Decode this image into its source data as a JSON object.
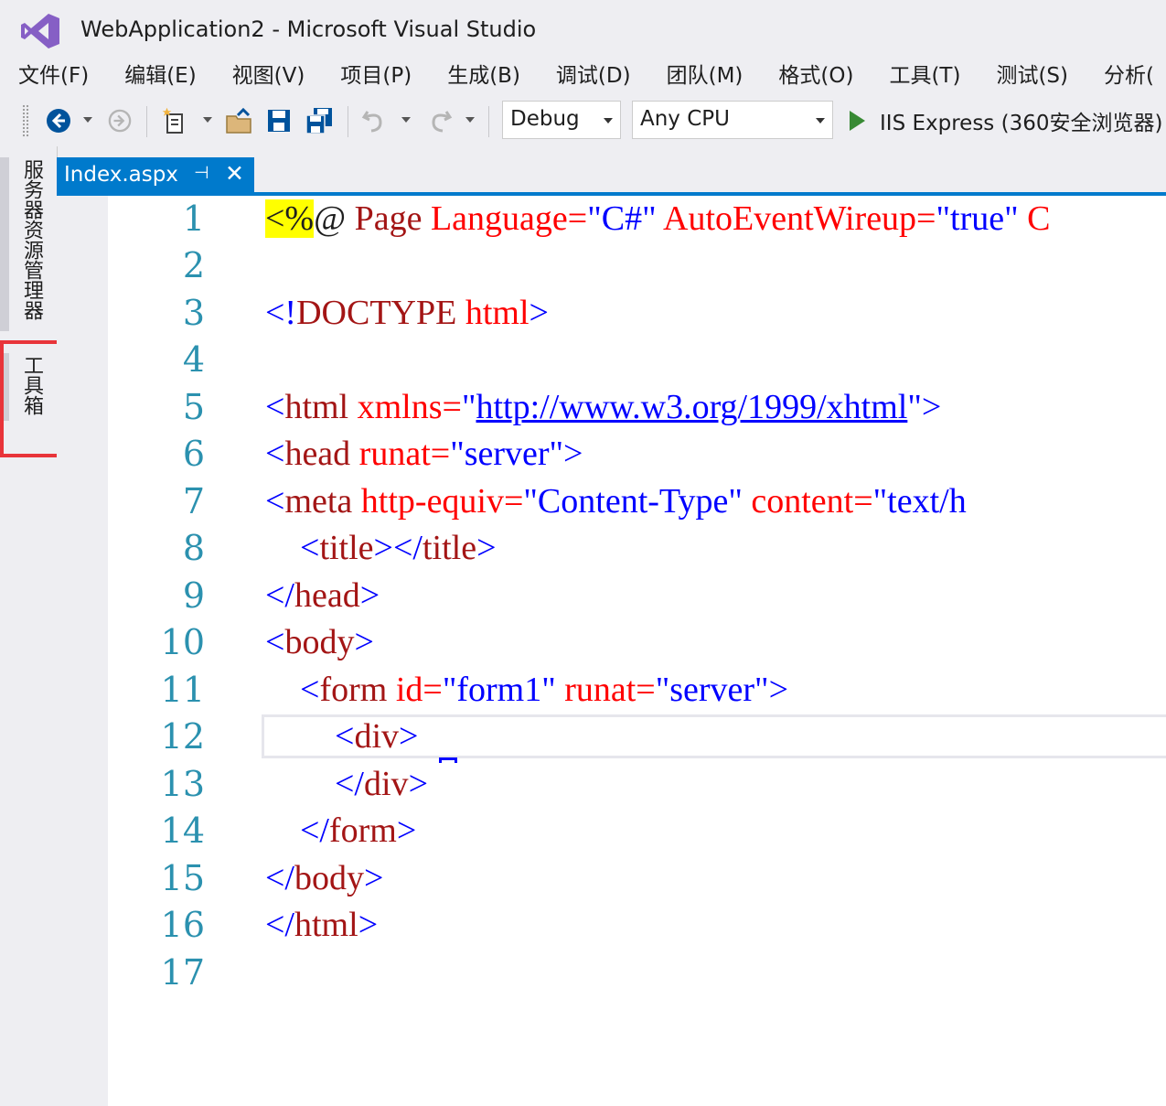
{
  "window": {
    "title": "WebApplication2 - Microsoft Visual Studio"
  },
  "menu": [
    "文件(F)",
    "编辑(E)",
    "视图(V)",
    "项目(P)",
    "生成(B)",
    "调试(D)",
    "团队(M)",
    "格式(O)",
    "工具(T)",
    "测试(S)",
    "分析("
  ],
  "toolbar": {
    "config": "Debug",
    "platform": "Any CPU",
    "run_target": "IIS Express (360安全浏览器)"
  },
  "side_tabs": {
    "server_explorer": "服务器资源管理器",
    "toolbox": "工具箱"
  },
  "document_tab": {
    "name": "Index.aspx",
    "pin": "⊣",
    "close": "✕"
  },
  "editor": {
    "line_numbers": [
      "1",
      "2",
      "3",
      "4",
      "5",
      "6",
      "7",
      "8",
      "9",
      "10",
      "11",
      "12",
      "13",
      "14",
      "15",
      "16",
      "17"
    ],
    "lines": {
      "l1": {
        "a": "<%",
        "b": "@ ",
        "c": "Page ",
        "d": "Language=",
        "e": "\"C#\" ",
        "f": "AutoEventWireup=",
        "g": "\"true\" ",
        "h": "C"
      },
      "l3": {
        "a": "<!",
        "b": "DOCTYPE ",
        "c": "html",
        "d": ">"
      },
      "l5": {
        "a": "<",
        "b": "html ",
        "c": "xmlns=",
        "d": "\"",
        "e": "http://www.w3.org/1999/xhtml",
        "f": "\"",
        "g": ">"
      },
      "l6": {
        "a": "<",
        "b": "head ",
        "c": "runat=",
        "d": "\"server\"",
        "e": ">"
      },
      "l7": {
        "a": "<",
        "b": "meta ",
        "c": "http-equiv=",
        "d": "\"Content-Type\" ",
        "e": "content=",
        "f": "\"text/h"
      },
      "l8": {
        "a": "    <",
        "b": "title",
        "c": "></",
        "d": "title",
        "e": ">"
      },
      "l9": {
        "a": "</",
        "b": "head",
        "c": ">"
      },
      "l10": {
        "a": "<",
        "b": "body",
        "c": ">"
      },
      "l11": {
        "a": "    <",
        "b": "form ",
        "c": "id=",
        "d": "\"form1\" ",
        "e": "runat=",
        "f": "\"server\"",
        "g": ">"
      },
      "l12": {
        "a": "        <",
        "b": "div",
        "c": ">"
      },
      "l13": {
        "a": "        </",
        "b": "div",
        "c": ">"
      },
      "l14": {
        "a": "    </",
        "b": "form",
        "c": ">"
      },
      "l15": {
        "a": "</",
        "b": "body",
        "c": ">"
      },
      "l16": {
        "a": "</",
        "b": "html",
        "c": ">"
      }
    }
  }
}
